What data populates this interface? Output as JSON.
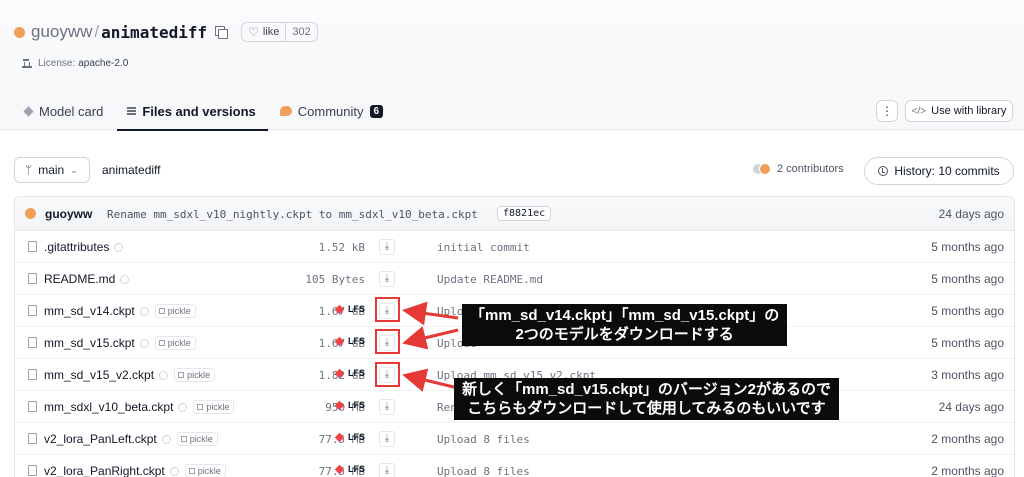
{
  "header": {
    "owner": "guoyww",
    "slash": "/",
    "repo": "animatediff",
    "like_label": "like",
    "like_count": "302",
    "license_label": "License:",
    "license_value": "apache-2.0"
  },
  "tabs": [
    {
      "label": "Model card",
      "active": false
    },
    {
      "label": "Files and versions",
      "active": true
    },
    {
      "label": "Community",
      "active": false,
      "badge": "6"
    }
  ],
  "actions": {
    "kebab": "⋮",
    "use_with_library_icon": "</>",
    "use_with_library": "Use with library"
  },
  "branch": {
    "icon": "ᛘ",
    "name": "main",
    "caret": "⌄",
    "breadcrumb": "animatediff",
    "contributors": "2 contributors",
    "history": "History: 10 commits"
  },
  "last_commit": {
    "user": "guoyww",
    "message": "Rename mm_sdxl_v10_nightly.ckpt to mm_sdxl_v10_beta.ckpt",
    "hash": "f8821ec",
    "time": "24 days ago"
  },
  "files": [
    {
      "name": ".gitattributes",
      "pickle": "",
      "size": "1.52 kB",
      "lfs": "",
      "message": "initial commit",
      "time": "5 months ago"
    },
    {
      "name": "README.md",
      "pickle": "",
      "size": "105 Bytes",
      "lfs": "",
      "message": "Update README.md",
      "time": "5 months ago"
    },
    {
      "name": "mm_sd_v14.ckpt",
      "pickle": "pickle",
      "size": "1.67 GB",
      "lfs": "LFS",
      "message": "Upload",
      "time": "5 months ago"
    },
    {
      "name": "mm_sd_v15.ckpt",
      "pickle": "pickle",
      "size": "1.67 GB",
      "lfs": "LFS",
      "message": "Upload",
      "time": "5 months ago"
    },
    {
      "name": "mm_sd_v15_v2.ckpt",
      "pickle": "pickle",
      "size": "1.82 GB",
      "lfs": "LFS",
      "message": "Upload mm_sd_v15_v2.ckpt",
      "time": "3 months ago"
    },
    {
      "name": "mm_sdxl_v10_beta.ckpt",
      "pickle": "pickle",
      "size": "950 MB",
      "lfs": "LFS",
      "message": "Rename",
      "time": "24 days ago"
    },
    {
      "name": "v2_lora_PanLeft.ckpt",
      "pickle": "pickle",
      "size": "77.5 MB",
      "lfs": "LFS",
      "message": "Upload 8 files",
      "time": "2 months ago"
    },
    {
      "name": "v2_lora_PanRight.ckpt",
      "pickle": "pickle",
      "size": "77.5 MB",
      "lfs": "LFS",
      "message": "Upload 8 files",
      "time": "2 months ago"
    }
  ],
  "download_icon": "⤓",
  "annotations": {
    "note1_line1": "「mm_sd_v14.ckpt」「mm_sd_v15.ckpt」の",
    "note1_line2": "2つのモデルをダウンロードする",
    "note2_line1": "新しく「mm_sd_v15.ckpt」のバージョン2があるので",
    "note2_line2": "こちらもダウンロードして使用してみるのもいいです"
  },
  "colors": {
    "annotation_red": "#e53935",
    "note_bg": "#0b0b0b",
    "accent_orange": "#f0a05a",
    "lfs_red": "#ef4444"
  }
}
